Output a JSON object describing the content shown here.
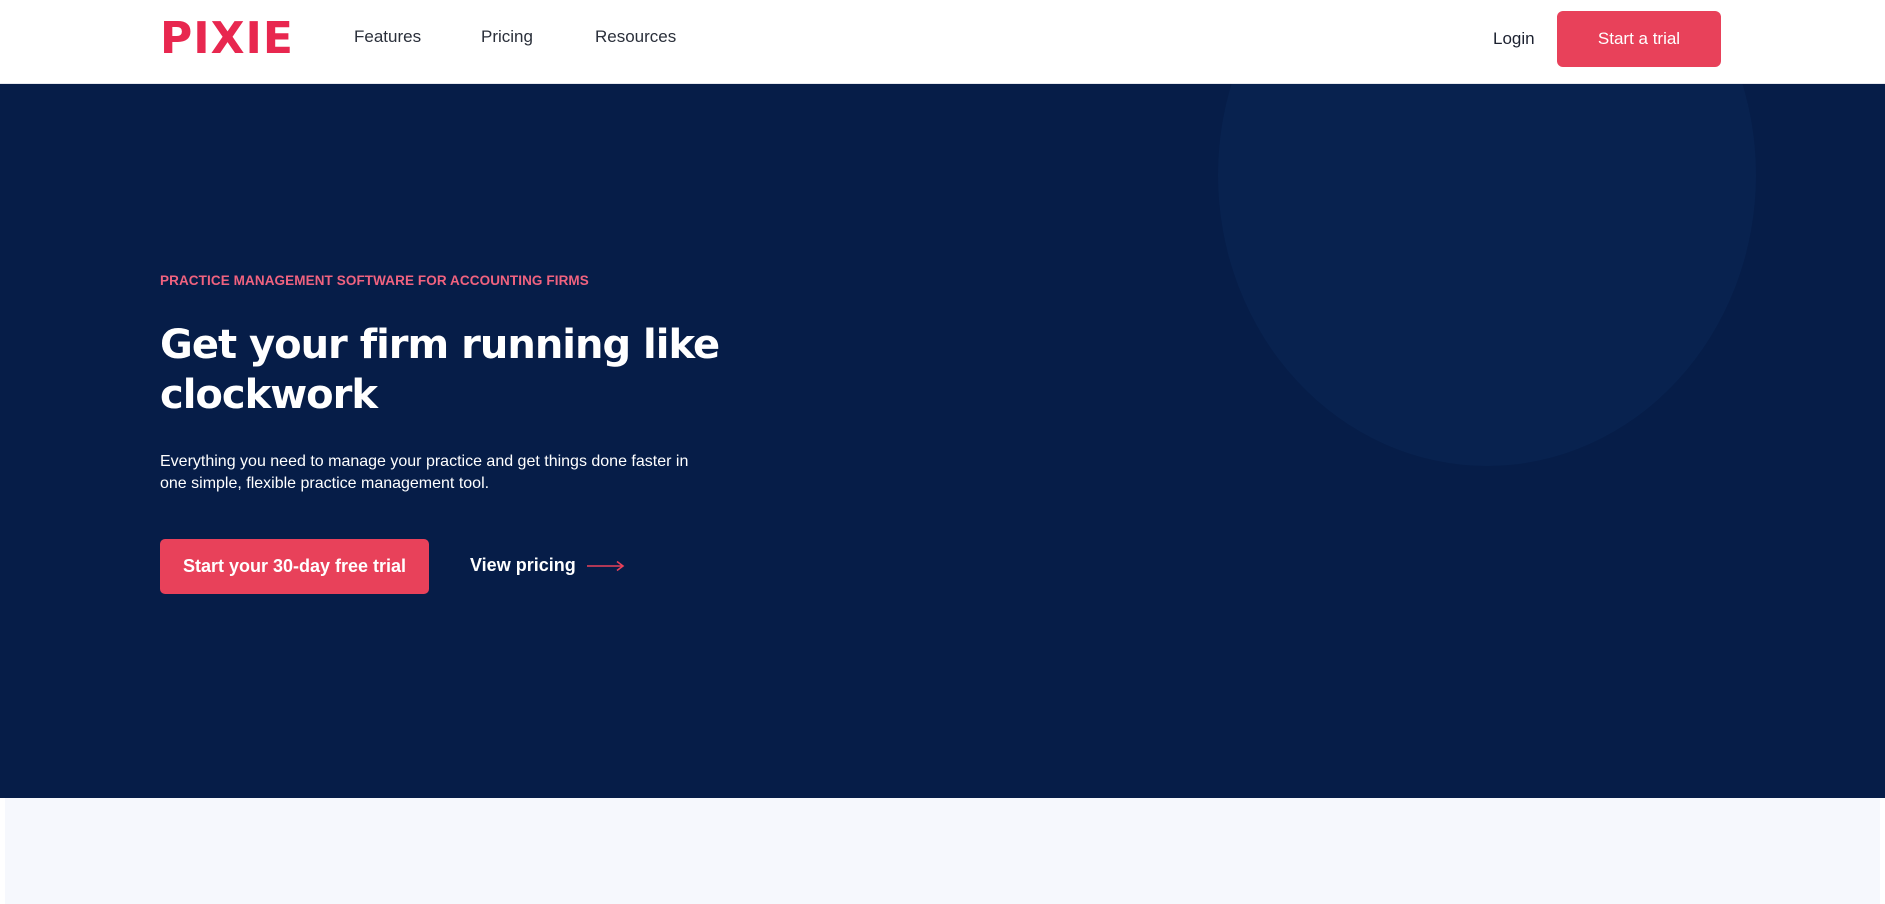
{
  "brand": {
    "logo_text": "PIXIE",
    "accent_color": "#e8415a",
    "logo_color": "#e8274f",
    "navy_color": "#061d48",
    "circle_color": "#08224f",
    "eyebrow_color": "#f0627f",
    "light_bg_color": "#f6f8fd"
  },
  "nav": {
    "links": [
      {
        "label": "Features"
      },
      {
        "label": "Pricing"
      },
      {
        "label": "Resources"
      }
    ],
    "login_label": "Login",
    "trial_button_label": "Start a trial"
  },
  "hero": {
    "eyebrow": "PRACTICE MANAGEMENT SOFTWARE FOR ACCOUNTING FIRMS",
    "headline": "Get your firm running like clockwork",
    "subtext": "Everything you need to manage your practice and get things done faster in one simple, flexible practice management tool.",
    "cta_label": "Start your 30-day free trial",
    "pricing_link_label": "View pricing",
    "pricing_link_icon": "arrow-right-icon"
  }
}
